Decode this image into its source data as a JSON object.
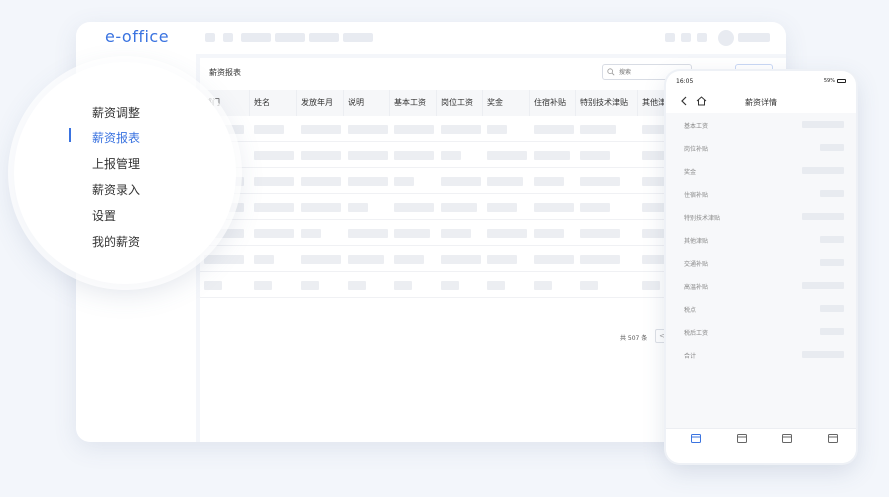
{
  "app": {
    "logo": "e-office"
  },
  "menu": {
    "items": [
      {
        "label": "薪资调整",
        "active": false
      },
      {
        "label": "薪资报表",
        "active": true
      },
      {
        "label": "上报管理",
        "active": false
      },
      {
        "label": "薪资录入",
        "active": false
      },
      {
        "label": "设置",
        "active": false
      },
      {
        "label": "我的薪资",
        "active": false
      }
    ]
  },
  "report": {
    "title": "薪资报表",
    "search_placeholder": "搜索",
    "columns": [
      "部门",
      "姓名",
      "发放年月",
      "说明",
      "基本工资",
      "岗位工资",
      "奖金",
      "住宿补贴",
      "特别技术津贴",
      "其他津贴"
    ],
    "pager": {
      "total": "共 507 条",
      "prev": "<"
    }
  },
  "mobile": {
    "status_time": "16:05",
    "status_battery": "59%",
    "title": "薪资详情",
    "fields": [
      "基本工资",
      "岗位补贴",
      "奖金",
      "住宿补贴",
      "特别技术津贴",
      "其他津贴",
      "交通补贴",
      "高温补贴",
      "税点",
      "税后工资",
      "合计"
    ]
  },
  "colors": {
    "accent": "#3a73e0",
    "placeholder": "#eceef2"
  },
  "icons": [
    "search-icon",
    "back-icon",
    "home-icon",
    "tab-icon"
  ]
}
